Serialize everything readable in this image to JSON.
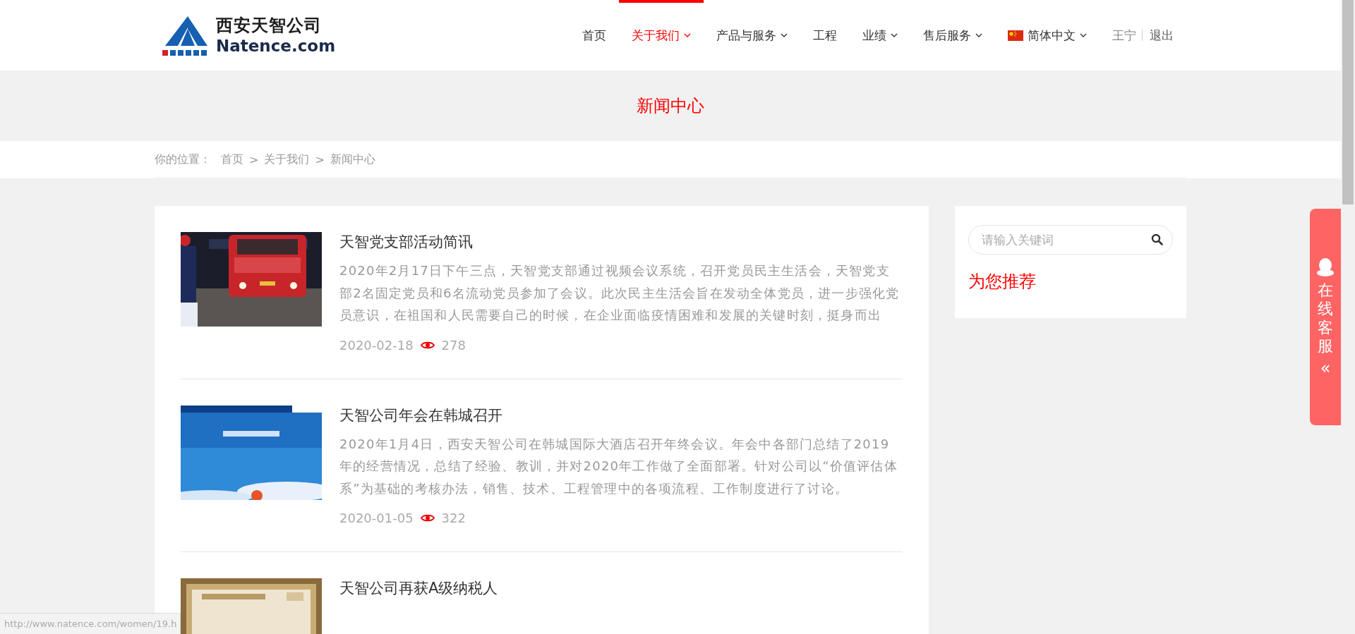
{
  "header": {
    "logo": {
      "name": "西安天智公司",
      "domain": "Natence.com"
    },
    "nav": [
      {
        "label": "首页",
        "selected": false,
        "dropdown": false
      },
      {
        "label": "关于我们",
        "selected": true,
        "dropdown": true
      },
      {
        "label": "产品与服务",
        "selected": false,
        "dropdown": true
      },
      {
        "label": "工程",
        "selected": false,
        "dropdown": false
      },
      {
        "label": "业绩",
        "selected": false,
        "dropdown": true
      },
      {
        "label": "售后服务",
        "selected": false,
        "dropdown": true
      }
    ],
    "language": {
      "label": "简体中文"
    },
    "user": {
      "name": "王宁",
      "logout": "退出"
    }
  },
  "banner": {
    "title": "新闻中心"
  },
  "breadcrumb": {
    "prefix": "你的位置：",
    "separator": ">",
    "items": [
      "首页",
      "关于我们",
      "新闻中心"
    ]
  },
  "articles": [
    {
      "title": "天智党支部活动简讯",
      "summary": "2020年2月17日下午三点，天智党支部通过视频会议系统，召开党员民主生活会，天智党支部2名固定党员和6名流动党员参加了会议。此次民主生活会旨在发动全体党员，进一步强化党员意识，在祖国和人民需要自己的时候，在企业面临疫情困难和发展的关键时刻，挺身而出",
      "date": "2020-02-18",
      "views": "278"
    },
    {
      "title": "天智公司年会在韩城召开",
      "summary": "2020年1月4日，西安天智公司在韩城国际大酒店召开年终会议。年会中各部门总结了2019年的经营情况，总结了经验、教训，并对2020年工作做了全面部署。针对公司以“价值评估体系”为基础的考核办法，销售、技术、工程管理中的各项流程、工作制度进行了讨论。",
      "date": "2020-01-05",
      "views": "322"
    },
    {
      "title": "天智公司再获A级纳税人"
    }
  ],
  "sidebar": {
    "search": {
      "placeholder": "请输入关键词"
    },
    "heading": "为您推荐"
  },
  "service_tab": {
    "label": "在线客服",
    "collapse": "«"
  },
  "status_url": "http://www.natence.com/women/19.h"
}
